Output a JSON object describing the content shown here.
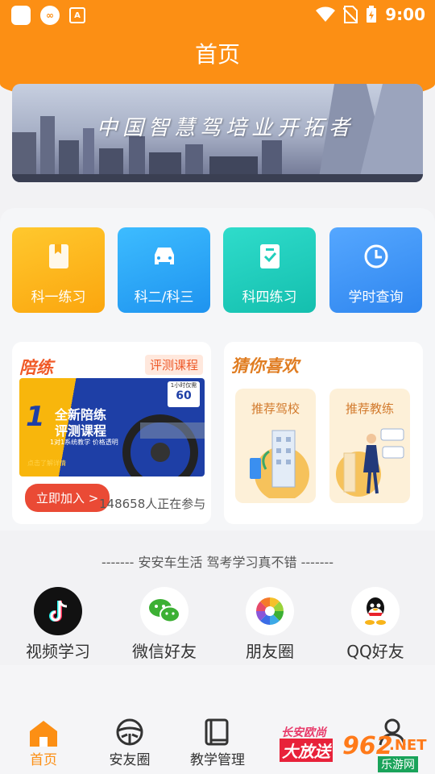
{
  "status": {
    "time": "9:00",
    "icons": [
      "app-icon",
      "infinity-icon",
      "a-icon"
    ]
  },
  "header": {
    "title": "首页"
  },
  "banner": {
    "text": "中国智慧驾培业开拓者"
  },
  "features": [
    {
      "label": "科一练习",
      "color": "#fdb31e",
      "icon": "book-icon"
    },
    {
      "label": "科二/科三",
      "color": "#26a5f5",
      "icon": "car-icon"
    },
    {
      "label": "科四练习",
      "color": "#20cfbc",
      "icon": "checklist-icon"
    },
    {
      "label": "学时查询",
      "color": "#3a95f5",
      "icon": "clock-icon"
    }
  ],
  "peilian": {
    "title": "陪练",
    "tag": "评测课程",
    "image": {
      "line1": "全新陪练",
      "line2": "评测课程",
      "price": "60",
      "price_top": "1小时仅需",
      "sub": "1对1系统教学 价格透明",
      "hint": "点击了解详情",
      "big_num": "1"
    },
    "join": "立即加入 >",
    "count": "148658人正在参与"
  },
  "guess": {
    "title": "猜你喜欢",
    "items": [
      "推荐驾校",
      "推荐教练"
    ]
  },
  "slogan": "-------  安安车生活  驾考学习真不错  -------",
  "share": [
    {
      "label": "视频学习",
      "icon": "tiktok-icon"
    },
    {
      "label": "微信好友",
      "icon": "wechat-icon"
    },
    {
      "label": "朋友圈",
      "icon": "moments-icon"
    },
    {
      "label": "QQ好友",
      "icon": "qq-icon"
    }
  ],
  "tabs": [
    {
      "label": "首页",
      "icon": "home-icon"
    },
    {
      "label": "安友圈",
      "icon": "steering-wheel-icon"
    },
    {
      "label": "教学管理",
      "icon": "book-stack-icon"
    },
    {
      "label": "",
      "icon": "user-icon"
    }
  ],
  "promo": {
    "line1": "长安欧尚",
    "line2": "大放送",
    "num": "962",
    "site": ".NET",
    "sub": "乐游网"
  },
  "colors": {
    "accent": "#fc8f14",
    "red": "#ea4a35"
  }
}
